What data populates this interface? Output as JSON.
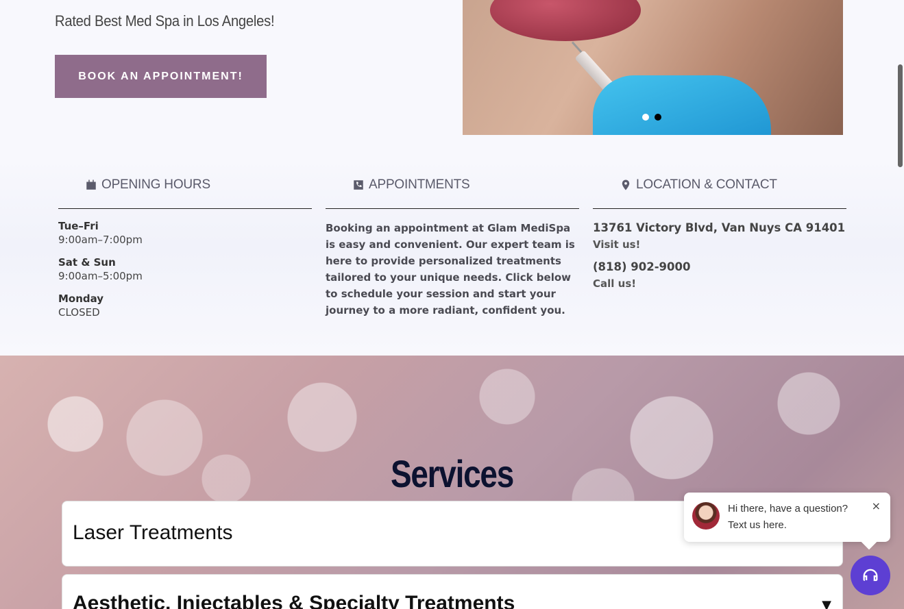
{
  "hero": {
    "tagline": "Rated Best Med Spa in Los Angeles!",
    "book_button": "BOOK AN APPOINTMENT!",
    "slides": 2,
    "active_slide": 2
  },
  "columns": {
    "hours": {
      "title": "OPENING HOURS",
      "icon": "calendar-icon",
      "rows": [
        {
          "day": "Tue–Fri",
          "time": "9:00am–7:00pm"
        },
        {
          "day": "Sat & Sun",
          "time": "9:00am–5:00pm"
        },
        {
          "day": "Monday",
          "time": "CLOSED"
        }
      ]
    },
    "appointments": {
      "title": "APPOINTMENTS",
      "icon": "phone-icon",
      "text": "Booking an appointment at Glam MediSpa is easy and convenient. Our expert team is here to provide personalized treatments tailored to your unique needs. Click below to schedule your session and start your journey to a more radiant, confident you."
    },
    "location": {
      "title": "LOCATION & CONTACT",
      "icon": "map-pin-icon",
      "address": "13761 Victory Blvd, Van Nuys CA 91401",
      "address_cta": "Visit us!",
      "phone": "(818) 902-9000",
      "phone_cta": "Call us!"
    }
  },
  "services": {
    "title": "Services",
    "items": [
      {
        "label": "Laser Treatments"
      },
      {
        "label": "Aesthetic, Injectables & Specialty Treatments"
      }
    ]
  },
  "chat": {
    "message": "Hi there, have a question? Text us here.",
    "close": "×"
  },
  "colors": {
    "button": "#8f6c8b",
    "services_title": "#0c1230",
    "chat_button": "#5d3fd3"
  }
}
